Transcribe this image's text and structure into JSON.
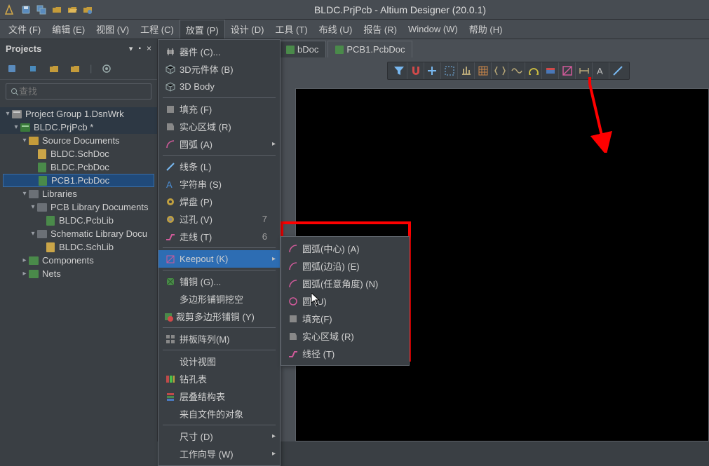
{
  "title": "BLDC.PrjPcb - Altium Designer (20.0.1)",
  "menus": [
    "文件 (F)",
    "编辑 (E)",
    "视图 (V)",
    "工程 (C)",
    "放置 (P)",
    "设计 (D)",
    "工具 (T)",
    "布线 (U)",
    "报告 (R)",
    "Window (W)",
    "帮助 (H)"
  ],
  "panel": {
    "title": "Projects",
    "search_placeholder": "查找"
  },
  "tree": [
    {
      "depth": 0,
      "caret": "▾",
      "icon": "project",
      "label": "Project Group 1.DsnWrk",
      "cls": "hl"
    },
    {
      "depth": 1,
      "caret": "▾",
      "icon": "pcbproj",
      "label": "BLDC.PrjPcb *",
      "cls": "hl"
    },
    {
      "depth": 2,
      "caret": "▾",
      "icon": "folder",
      "label": "Source Documents"
    },
    {
      "depth": 3,
      "caret": "",
      "icon": "sch",
      "label": "BLDC.SchDoc"
    },
    {
      "depth": 3,
      "caret": "",
      "icon": "pcb",
      "label": "BLDC.PcbDoc"
    },
    {
      "depth": 3,
      "caret": "",
      "icon": "pcb",
      "label": "PCB1.PcbDoc",
      "cls": "selected"
    },
    {
      "depth": 2,
      "caret": "▾",
      "icon": "folder-gray",
      "label": "Libraries"
    },
    {
      "depth": 3,
      "caret": "▾",
      "icon": "folder-gray",
      "label": "PCB Library Documents"
    },
    {
      "depth": 4,
      "caret": "",
      "icon": "pcb",
      "label": "BLDC.PcbLib"
    },
    {
      "depth": 3,
      "caret": "▾",
      "icon": "folder-gray",
      "label": "Schematic Library Docu"
    },
    {
      "depth": 4,
      "caret": "",
      "icon": "sch",
      "label": "BLDC.SchLib"
    },
    {
      "depth": 2,
      "caret": "▸",
      "icon": "folder-green",
      "label": "Components"
    },
    {
      "depth": 2,
      "caret": "▸",
      "icon": "folder-green",
      "label": "Nets"
    }
  ],
  "tabs": [
    {
      "label": "bDoc",
      "active": false
    },
    {
      "label": "PCB1.PcbDoc",
      "active": true
    }
  ],
  "place_menu": [
    {
      "icon": "comp",
      "label": "器件 (C)...",
      "sc": "",
      "sub": false
    },
    {
      "icon": "3dbody",
      "label": "3D元件体 (B)",
      "sc": "",
      "sub": false
    },
    {
      "icon": "3dbody2",
      "label": "3D Body",
      "sc": "",
      "sub": false
    },
    {
      "sep": true
    },
    {
      "icon": "fill",
      "label": "填充 (F)",
      "sc": "",
      "sub": false
    },
    {
      "icon": "region",
      "label": "实心区域 (R)",
      "sc": "",
      "sub": false
    },
    {
      "icon": "arc",
      "label": "圆弧 (A)",
      "sc": "",
      "sub": true
    },
    {
      "sep": true
    },
    {
      "icon": "line",
      "label": "线条 (L)",
      "sc": "",
      "sub": false
    },
    {
      "icon": "text",
      "label": "字符串 (S)",
      "sc": "",
      "sub": false
    },
    {
      "icon": "pad",
      "label": "焊盘 (P)",
      "sc": "",
      "sub": false
    },
    {
      "icon": "via",
      "label": "过孔 (V)",
      "sc": "7",
      "sub": false
    },
    {
      "icon": "track",
      "label": "走线 (T)",
      "sc": "6",
      "sub": false
    },
    {
      "sep": true
    },
    {
      "icon": "keepout",
      "label": "Keepout (K)",
      "sc": "",
      "sub": true,
      "hover": true
    },
    {
      "sep": true
    },
    {
      "icon": "poly",
      "label": "铺铜 (G)...",
      "sc": "",
      "sub": false
    },
    {
      "icon": "",
      "label": "多边形铺铜挖空",
      "sc": "",
      "sub": false
    },
    {
      "icon": "cut",
      "label": "裁剪多边形铺铜 (Y)",
      "sc": "",
      "sub": false
    },
    {
      "sep": true
    },
    {
      "icon": "array",
      "label": "拼板阵列(M)",
      "sc": "",
      "sub": false
    },
    {
      "sep": true
    },
    {
      "icon": "",
      "label": "设计视图",
      "sc": "",
      "sub": false
    },
    {
      "icon": "drill",
      "label": "钻孔表",
      "sc": "",
      "sub": false
    },
    {
      "icon": "stack",
      "label": "层叠结构表",
      "sc": "",
      "sub": false
    },
    {
      "icon": "",
      "label": "来自文件的对象",
      "sc": "",
      "sub": false
    },
    {
      "sep": true
    },
    {
      "icon": "",
      "label": "尺寸 (D)",
      "sc": "",
      "sub": true
    },
    {
      "icon": "",
      "label": "工作向导 (W)",
      "sc": "",
      "sub": true
    }
  ],
  "keepout_sub": [
    {
      "icon": "arc",
      "label": "圆弧(中心) (A)"
    },
    {
      "icon": "arc",
      "label": "圆弧(边沿) (E)"
    },
    {
      "icon": "arc",
      "label": "圆弧(任意角度) (N)"
    },
    {
      "icon": "circ",
      "label": "圆 (U)"
    },
    {
      "icon": "fill",
      "label": "填充(F)"
    },
    {
      "icon": "region",
      "label": "实心区域 (R)"
    },
    {
      "icon": "track",
      "label": "线径 (T)"
    }
  ],
  "etb": [
    "filter",
    "magnet",
    "plus",
    "select",
    "align",
    "grid",
    "flip",
    "wave",
    "omega",
    "layer",
    "keepout",
    "dim",
    "text",
    "line"
  ]
}
